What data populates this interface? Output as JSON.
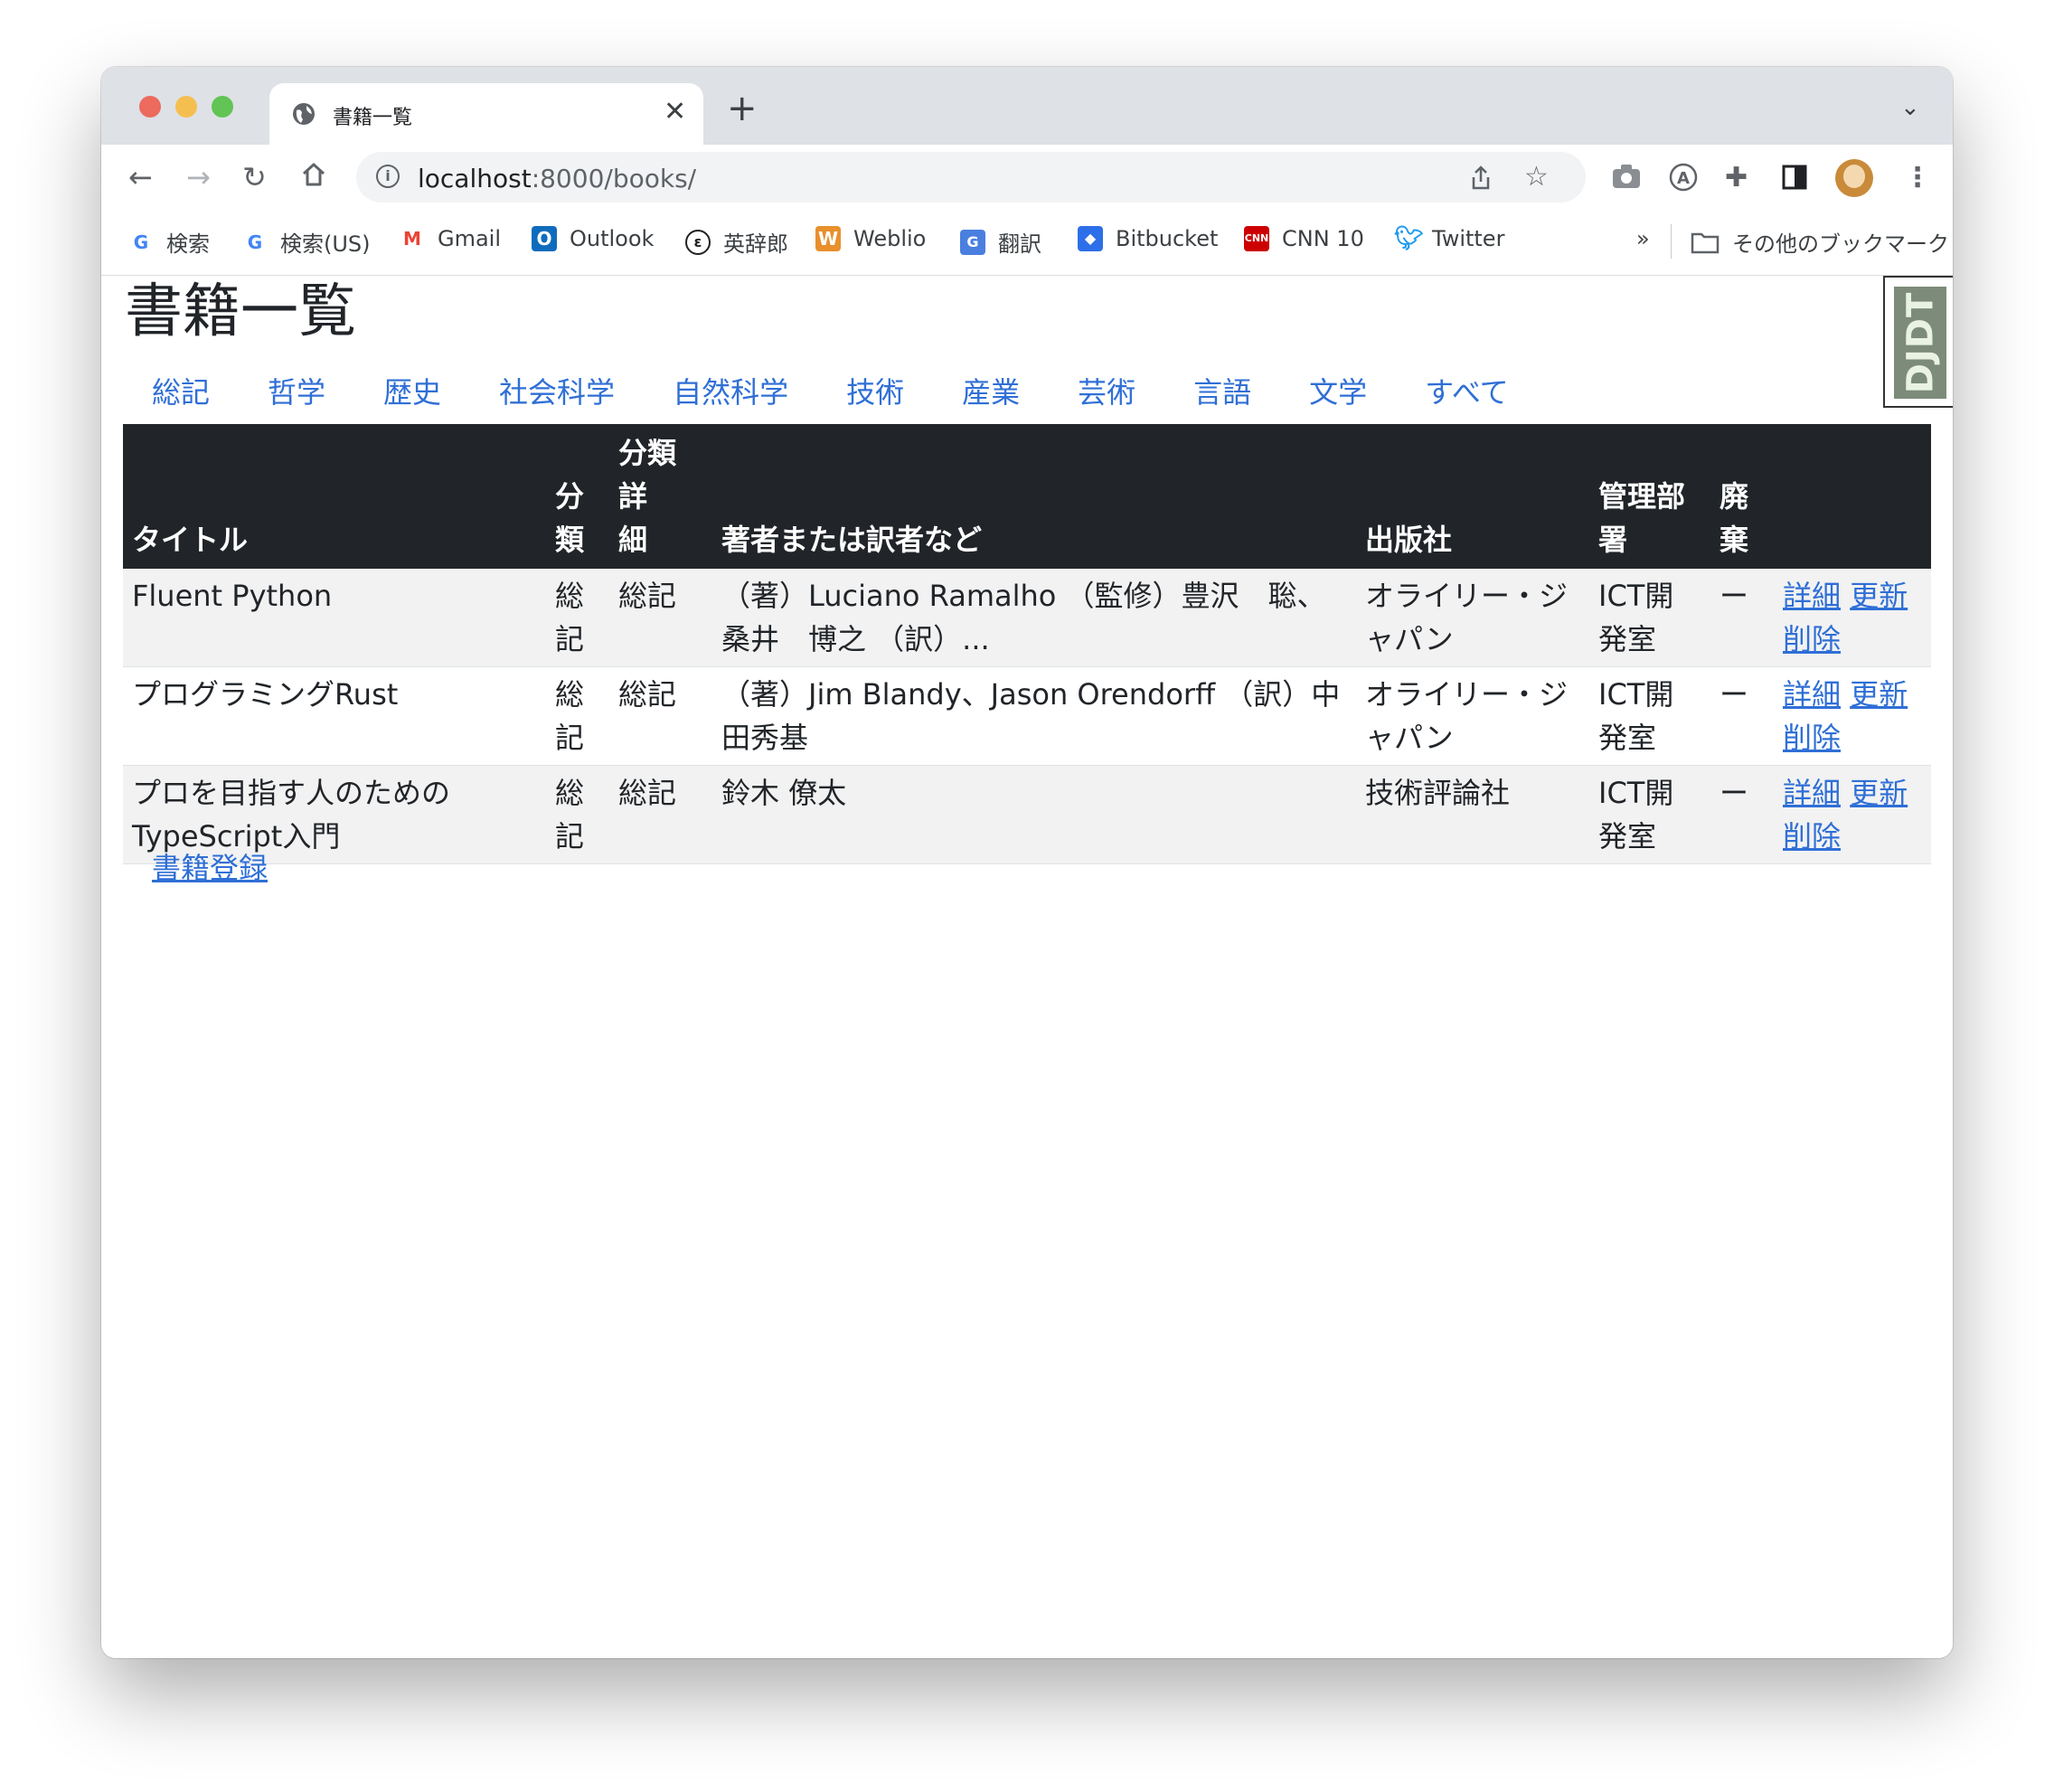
{
  "browser": {
    "tab_title": "書籍一覧",
    "url_host": "localhost",
    "url_rest": ":8000/books/",
    "bookmarks": [
      {
        "label": "検索",
        "icon": "google-icon"
      },
      {
        "label": "検索(US)",
        "icon": "google-icon"
      },
      {
        "label": "Gmail",
        "icon": "gmail-icon"
      },
      {
        "label": "Outlook",
        "icon": "outlook-icon"
      },
      {
        "label": "英辞郎",
        "icon": "eijiro-icon"
      },
      {
        "label": "Weblio",
        "icon": "weblio-icon"
      },
      {
        "label": "翻訳",
        "icon": "translate-icon"
      },
      {
        "label": "Bitbucket",
        "icon": "bitbucket-icon"
      },
      {
        "label": "CNN 10",
        "icon": "cnn-icon"
      },
      {
        "label": "Twitter",
        "icon": "twitter-icon"
      }
    ],
    "bookmarks_overflow": "»",
    "other_bookmarks": "その他のブックマーク"
  },
  "page": {
    "title": "書籍一覧",
    "categories": [
      "総記",
      "哲学",
      "歴史",
      "社会科学",
      "自然科学",
      "技術",
      "産業",
      "芸術",
      "言語",
      "文学",
      "すべて"
    ],
    "djdt": "DJDT",
    "table": {
      "headers": {
        "title": "タイトル",
        "category_line1": "分",
        "category_line2": "類",
        "detail_line1": "分類詳",
        "detail_line2": "細",
        "author": "著者または訳者など",
        "publisher": "出版社",
        "dept_line1": "管理部",
        "dept_line2": "署",
        "disposal_line1": "廃",
        "disposal_line2": "棄"
      },
      "rows": [
        {
          "title": "Fluent Python",
          "category_line1": "総",
          "category_line2": "記",
          "detail": "総記",
          "author": "（著）Luciano Ramalho （監修）豊沢　聡、桑井　博之 （訳）...",
          "publisher": "オライリー・ジャパン",
          "dept": "ICT開発室",
          "disposal": "ー",
          "link_detail": "詳細",
          "link_update": "更新",
          "link_delete": "削除"
        },
        {
          "title": "プログラミングRust",
          "category_line1": "総",
          "category_line2": "記",
          "detail": "総記",
          "author": "（著）Jim Blandy、Jason Orendorff （訳）中田秀基",
          "publisher": "オライリー・ジャパン",
          "dept": "ICT開発室",
          "disposal": "ー",
          "link_detail": "詳細",
          "link_update": "更新",
          "link_delete": "削除"
        },
        {
          "title": "プロを目指す人のためのTypeScript入門",
          "category_line1": "総",
          "category_line2": "記",
          "detail": "総記",
          "author": "鈴木 僚太",
          "publisher": "技術評論社",
          "dept": "ICT開発室",
          "disposal": "ー",
          "link_detail": "詳細",
          "link_update": "更新",
          "link_delete": "削除"
        }
      ]
    },
    "register_link": "書籍登録"
  }
}
